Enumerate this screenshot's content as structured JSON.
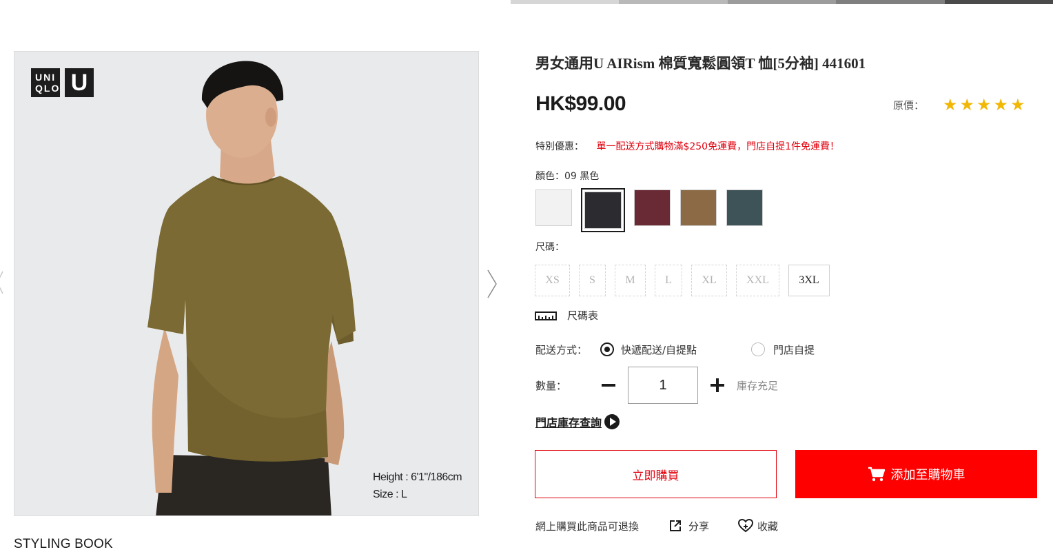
{
  "progress_colors": [
    "#d6d6d6",
    "#b9b9b9",
    "#9c9c9c",
    "#7f7f7f",
    "#4a4a4a"
  ],
  "brand": {
    "logo_top": "UNI",
    "logo_bottom": "QLO",
    "logo_u": "U"
  },
  "photo": {
    "caption_height": "Height : 6'1\"/186cm",
    "caption_size": "Size : L"
  },
  "styling_book": "STYLING BOOK",
  "product": {
    "title": "男女通用U AIRism 棉質寬鬆圓領T 恤[5分袖] 441601",
    "price": "HK$99.00",
    "original_price_label": "原價：",
    "rating_stars": 5,
    "promo_label": "特別優惠：",
    "promo_text": "單一配送方式購物滿$250免運費，門店自提1件免運費！",
    "color_label": "顏色：09 黑色",
    "colors": [
      {
        "name": "white",
        "hex": "#f2f2f2",
        "selected": false
      },
      {
        "name": "black",
        "hex": "#2c2c30",
        "selected": true
      },
      {
        "name": "wine",
        "hex": "#6a2a35",
        "selected": false
      },
      {
        "name": "brown",
        "hex": "#8b6a45",
        "selected": false
      },
      {
        "name": "teal",
        "hex": "#3d5358",
        "selected": false
      }
    ],
    "size_label": "尺碼：",
    "sizes": [
      {
        "label": "XS",
        "available": false
      },
      {
        "label": "S",
        "available": false
      },
      {
        "label": "M",
        "available": false
      },
      {
        "label": "L",
        "available": false
      },
      {
        "label": "XL",
        "available": false
      },
      {
        "label": "XXL",
        "available": false
      },
      {
        "label": "3XL",
        "available": true
      }
    ],
    "size_chart_label": "尺碼表",
    "delivery_label": "配送方式：",
    "delivery_options": [
      "快遞配送/自提點",
      "門店自提"
    ],
    "quantity_label": "數量：",
    "quantity_value": "1",
    "stock_status": "庫存充足",
    "store_stock_link": "門店庫存查詢",
    "buy_now": "立即購買",
    "add_to_cart": "添加至購物車",
    "returns_note": "網上購買此商品可退換",
    "share": "分享",
    "favorite": "收藏"
  }
}
